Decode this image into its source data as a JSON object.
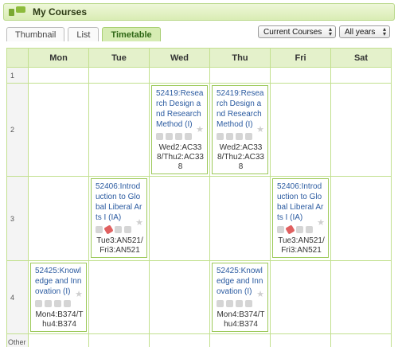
{
  "header": {
    "title": "My Courses"
  },
  "tabs": [
    {
      "label": "Thumbnail"
    },
    {
      "label": "List"
    },
    {
      "label": "Timetable"
    }
  ],
  "filters": {
    "courses": "Current Courses",
    "years": "All years"
  },
  "table": {
    "days": [
      "Mon",
      "Tue",
      "Wed",
      "Thu",
      "Fri",
      "Sat"
    ],
    "periods": [
      "1",
      "2",
      "3",
      "4",
      "Other"
    ],
    "courses": {
      "wed2": {
        "name": "52419:Research Design and Research Method (I)",
        "room": "Wed2:AC338/Thu2:AC338"
      },
      "thu2": {
        "name": "52419:Research Design and Research Method (I)",
        "room": "Wed2:AC338/Thu2:AC338"
      },
      "tue3": {
        "name": "52406:Introduction to Global Liberal Arts I (IA)",
        "room": "Tue3:AN521/Fri3:AN521"
      },
      "fri3": {
        "name": "52406:Introduction to Global Liberal Arts I (IA)",
        "room": "Tue3:AN521/Fri3:AN521"
      },
      "mon4": {
        "name": "52425:Knowledge and Innovation (I)",
        "room": "Mon4:B374/Thu4:B374"
      },
      "thu4": {
        "name": "52425:Knowledge and Innovation (I)",
        "room": "Mon4:B374/Thu4:B374"
      }
    }
  },
  "colors": {
    "accent": "#8dbb3c",
    "link": "#2a5aa0",
    "grid": "#c2e08e"
  }
}
